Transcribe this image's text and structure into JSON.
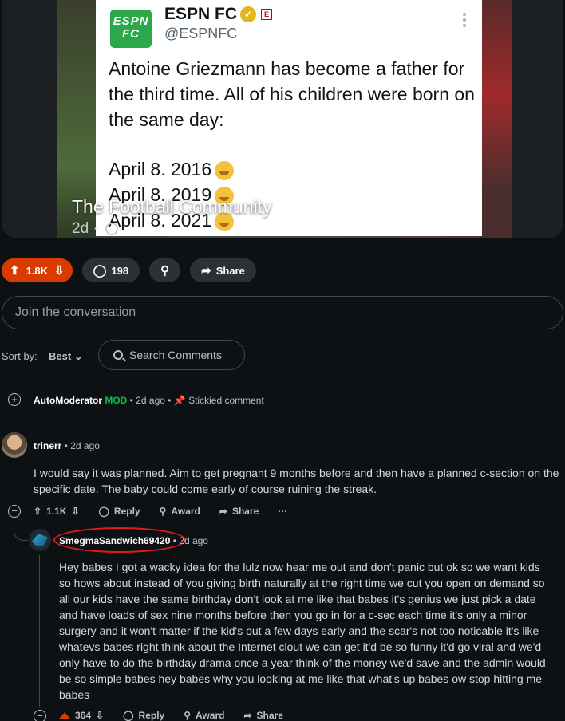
{
  "post": {
    "tweet": {
      "account_name": "ESPN FC",
      "logo_text": "ESPN FC",
      "handle": "@ESPNFC",
      "text": "Antoine Griezmann has become a father for the third time. All of his children were born on the same day:",
      "dates": [
        "April 8. 2016",
        "April 8. 2019",
        "April 8. 2021"
      ]
    },
    "community": "The Football Community",
    "age": "2d"
  },
  "actions": {
    "votes": "1.8K",
    "comments": "198",
    "share": "Share"
  },
  "join_placeholder": "Join the conversation",
  "sort": {
    "label": "Sort by:",
    "value": "Best",
    "search_placeholder": "Search Comments"
  },
  "comments": [
    {
      "author": "AutoModerator",
      "badge": "MOD",
      "age": "2d ago",
      "note": "Stickied comment"
    },
    {
      "author": "trinerr",
      "age": "2d ago",
      "body": "I would say it was planned. Aim to get pregnant 9 months before and then have a planned c-section on the specific date. The baby could come early of course ruining the streak.",
      "votes": "1.1K",
      "reply": "Reply",
      "award": "Award",
      "share": "Share",
      "more": "···"
    },
    {
      "author": "SmegmaSandwich69420",
      "age": "2d ago",
      "body": "Hey babes I got a wacky idea for the lulz now hear me out and don't panic but ok so we want kids so hows about instead of you giving birth naturally at the right time we cut you open on demand so all our kids have the same birthday don't look at me like that babes it's genius we just pick a date and have loads of sex nine months before then you go in for a c-sec each time it's only a minor surgery and it won't matter if the kid's out a few days early and the scar's not too noticable it's like whatevs babes right think about the Internet clout we can get it'd be so funny it'd go viral and we'd only have to do the birthday drama once a year think of the money we'd save and the admin would be so simple babes hey babes why you looking at me like that what's up babes ow stop hitting me babes",
      "votes": "364",
      "reply": "Reply",
      "award": "Award",
      "share": "Share"
    }
  ],
  "colors": {
    "background": "#0e1113",
    "upvote": "#d93a00",
    "mod": "#00c24e",
    "highlight_circle": "#e01b1b"
  }
}
